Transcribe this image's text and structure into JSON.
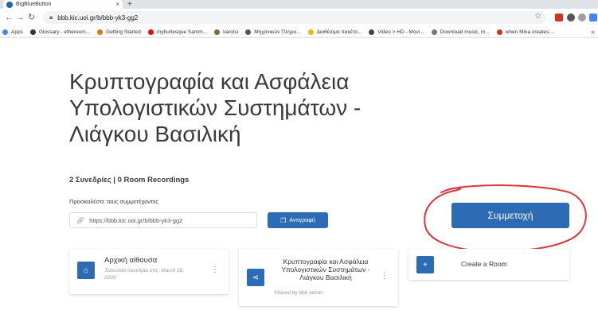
{
  "browser": {
    "tab_title": "BigBlueButton",
    "tab_close": "×",
    "new_tab": "+",
    "url": "bbb.kic.uoi.gr/b/bbb-yk3-gg2",
    "bookmarks": [
      {
        "label": "Apps",
        "color": "#4285f4"
      },
      {
        "label": "Glossary - ethereum...",
        "color": "#333333"
      },
      {
        "label": "Getting Started",
        "color": "#e8710a"
      },
      {
        "label": "myburlesque Samm...",
        "color": "#ff0000"
      },
      {
        "label": "karotsi",
        "color": "#7b6b3a"
      },
      {
        "label": "Μηχανικών Πληρο...",
        "color": "#555555"
      },
      {
        "label": "Διαθέσιμα πακέτα...",
        "color": "#f4b400"
      },
      {
        "label": "Video > HD - Movi...",
        "color": "#444444"
      },
      {
        "label": "Download music, m...",
        "color": "#777777"
      },
      {
        "label": "when Mina creates:...",
        "color": "#d93025"
      }
    ],
    "bookmarks_more": "»"
  },
  "room": {
    "title": "Κρυπτογραφία και Ασφάλεια Υπολογιστικών Συστημάτων - Λιάγκου Βασιλική",
    "sessions": "2 Συνεδρίες | 0 Room Recordings",
    "invite_label": "Προσκαλέστε τους συμμετέχοντες",
    "invite_url": "https://bbb.kic.uoi.gr/b/bbb-yk3-gg2",
    "copy_label": "Αντιγραφή",
    "join_label": "Συμμετοχή"
  },
  "cards": [
    {
      "name": "Αρχική αίθουσα",
      "sub": "Τελευταία συνεδρία στις: March 16, 2020",
      "icon": "home-icon"
    },
    {
      "name": "Κρυπτογραφία και Ασφάλεια Υπολογιστικών Συστημάτων - Λιάγκου Βασιλική",
      "sub": "Shared by bbb admin",
      "icon": "share-icon"
    },
    {
      "name": "Create a Room",
      "icon": "plus-icon"
    }
  ],
  "colors": {
    "accent": "#2d6bb5",
    "annotation": "#d9363e"
  }
}
